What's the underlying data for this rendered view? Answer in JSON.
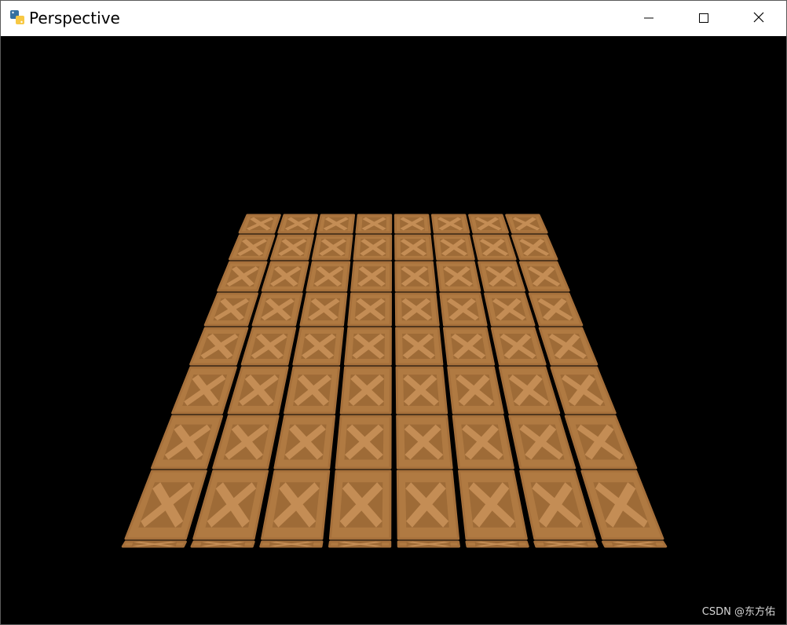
{
  "window": {
    "title": "Perspective",
    "app_icon": "python-icon",
    "controls": {
      "minimize_icon": "minimize-icon",
      "maximize_icon": "maximize-icon",
      "close_icon": "close-icon"
    }
  },
  "scene": {
    "background": "#000000",
    "floor_colors": {
      "base": "#b07a42",
      "light": "#c48d55",
      "dark": "#8f5f2f",
      "edge": "#a6703b"
    }
  },
  "watermark": {
    "text": "CSDN @东方佑"
  }
}
